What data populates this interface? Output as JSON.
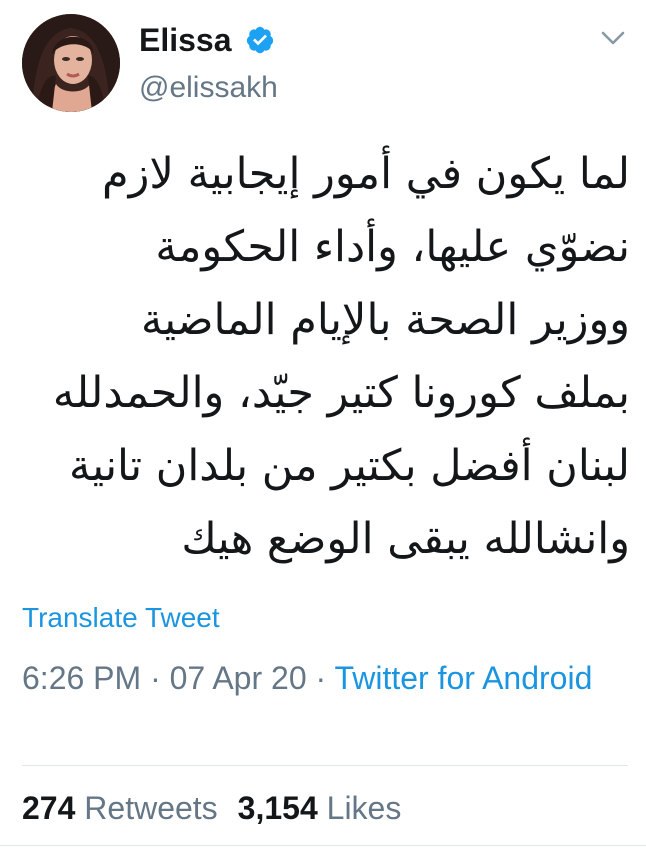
{
  "author": {
    "display_name": "Elissa",
    "handle": "@elissakh",
    "verified": true
  },
  "icons": {
    "avatar": "profile-photo",
    "verified": "verified-badge-icon",
    "menu": "chevron-down-icon"
  },
  "tweet": {
    "lines": [
      "لما يكون في أمور إيجابية لازم",
      "نضوّي عليها، وأداء الحكومة",
      "ووزير الصحة بالإيام الماضية",
      "بملف كورونا كتير جيّد، والحمدلله",
      "لبنان أفضل بكتير من بلدان تانية",
      "وانشالله يبقى الوضع هيك"
    ],
    "translate_label": "Translate Tweet"
  },
  "meta": {
    "time": "6:26 PM",
    "separator": " · ",
    "date": "07 Apr 20",
    "source": "Twitter for Android"
  },
  "stats": {
    "retweets_count": "274",
    "retweets_label": "Retweets",
    "likes_count": "3,154",
    "likes_label": "Likes"
  },
  "colors": {
    "link": "#1b95e0",
    "secondary_text": "#657786",
    "primary_text": "#14171a",
    "verified_badge": "#1da1f2",
    "divider": "#e1e8ed"
  }
}
